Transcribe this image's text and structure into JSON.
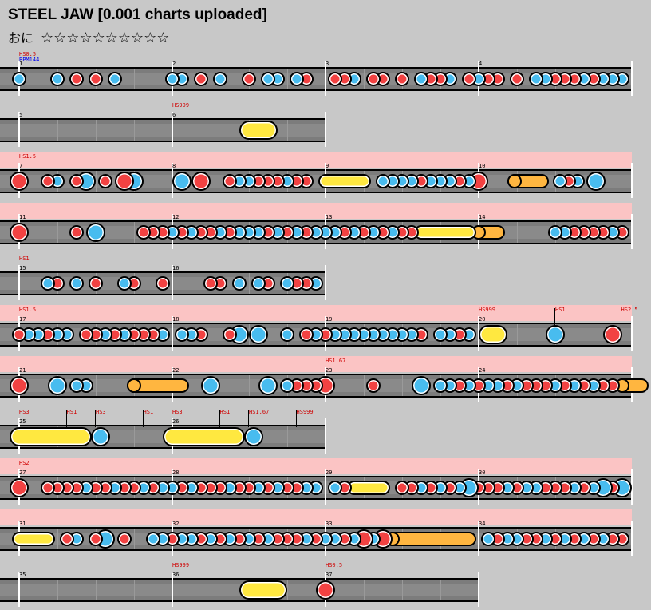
{
  "header": {
    "title": "STEEL JAW [0.001 charts uploaded]",
    "difficulty_label": "おに",
    "stars": "☆☆☆☆☆☆☆☆☆☆"
  },
  "colors": {
    "background": "#c8c8c8",
    "lane": "#7c7c7c",
    "don": "#f24242",
    "ka": "#48bcef",
    "drumroll": "#ffe840",
    "balloon": "#ffb640",
    "scroll_highlight": "#fbc4c4",
    "scroll_text": "#d00000",
    "bpm_text": "#0000ee"
  },
  "notation": {
    "d": "don",
    "k": "ka",
    "D": "big-don",
    "K": "big-ka",
    "r": "drumroll",
    "R": "big-drumroll",
    "b": "balloon",
    "e": "drumroll-end",
    "0": "rest"
  },
  "rows": [
    {
      "measures": 4,
      "highlight": false,
      "labels": [
        {
          "m": 1,
          "text": "HS0.5"
        }
      ],
      "bpm": [
        {
          "m": 1,
          "text": "BPM144"
        }
      ],
      "measure_numbers": [
        "1",
        "2",
        "3",
        "4"
      ],
      "lines": [
        "k000k0d0d0k00000",
        "kk0d0k00d0kk0kd0",
        "0ddk0dd0d0kddk0d",
        "kdd0d0kkdddkdkkk"
      ]
    },
    {
      "measures": 2,
      "highlight": false,
      "labels": [
        {
          "m": 2,
          "text": "HS999"
        }
      ],
      "measure_numbers": [
        "5",
        "6"
      ],
      "lines": [
        "0000000000000000",
        "00000000R0eeeeee"
      ]
    },
    {
      "measures": 4,
      "highlight": true,
      "labels": [
        {
          "m": 1,
          "text": "HS1.5"
        }
      ],
      "measure_numbers": [
        "7",
        "8",
        "9",
        "10"
      ],
      "lines": [
        "D00dk0dK0d0DK000",
        "0K0D00dkkdddkdd0",
        "r000e0kkkkdkkkdk",
        "D000b00e0kdk0K00e"
      ]
    },
    {
      "measures": 4,
      "highlight": true,
      "labels": [],
      "measure_numbers": [
        "11",
        "12",
        "13",
        "14"
      ],
      "lines": [
        "D000e0d0K0000ddd",
        "kdkddkdkkkdkdkdk",
        "kkdkdkdkddr0000e",
        "b0000000kkddddkd"
      ]
    },
    {
      "measures": 2,
      "highlight": false,
      "labels": [
        {
          "m": 1,
          "text": "HS1"
        }
      ],
      "measure_numbers": [
        "15",
        "16"
      ],
      "lines": [
        "000kd0k0d00kd00d",
        "0000dd0k0kd0kddk"
      ]
    },
    {
      "measures": 4,
      "highlight": true,
      "labels": [
        {
          "m": 1,
          "text": "HS1.5"
        },
        {
          "m": 4,
          "text": "HS999"
        },
        {
          "m": 4,
          "text": "HS1",
          "at": 0.5
        },
        {
          "m": 4,
          "text": "HS2.5",
          "at": 0.93
        }
      ],
      "measure_numbers": [
        "17",
        "18",
        "19",
        "20"
      ],
      "lines": [
        "dkkdkk0ddkdkdddk",
        "0kkd00dK0K00k0dk",
        "dkkkkkkkkkd0kkdk",
        "0Reeeee0K00000D0"
      ]
    },
    {
      "measures": 4,
      "highlight": true,
      "labels": [
        {
          "m": 3,
          "text": "HS1.67"
        }
      ],
      "measure_numbers": [
        "21",
        "22",
        "23",
        "24"
      ],
      "lines": [
        "D000K0kk0r00b000",
        "0e00K0r000K0kddd",
        "D0000d0000K0kkdk",
        "dkkdkdddkdkdkddb"
      ]
    },
    {
      "measures": 2,
      "highlight": false,
      "labels": [
        {
          "m": 1,
          "text": "HS3"
        },
        {
          "m": 1,
          "text": "HS1",
          "at": 0.31
        },
        {
          "m": 1,
          "text": "HS3",
          "at": 0.5
        },
        {
          "m": 1,
          "text": "HS1",
          "at": 0.81
        },
        {
          "m": 2,
          "text": "HS3"
        },
        {
          "m": 2,
          "text": "HS1",
          "at": 0.31
        },
        {
          "m": 2,
          "text": "HS1.67",
          "at": 0.5
        },
        {
          "m": 2,
          "text": "HS999",
          "at": 0.81
        }
      ],
      "measure_numbers": [
        "25",
        "26"
      ],
      "lines": [
        "R000000e0K000000e",
        "R000000e0K000000e"
      ]
    },
    {
      "measures": 4,
      "highlight": true,
      "labels": [
        {
          "m": 1,
          "text": "HS2"
        }
      ],
      "measure_numbers": [
        "27",
        "28",
        "29",
        "30"
      ],
      "lines": [
        "D00ddddkddkddkdk",
        "kdkdddkddkdkddkk",
        "0kdr00e0ddkdkdkK",
        "dddkdkkdddkdkKdK"
      ]
    },
    {
      "measures": 4,
      "highlight": true,
      "labels": [],
      "measure_numbers": [
        "31",
        "32",
        "33",
        "34"
      ],
      "lines": [
        "r00e0dk0dK0d00kk",
        "dkkdkdkdkdkdddkd",
        "kkdkDkDb0000000e",
        "0kdkkddkdkdkdkdd"
      ]
    },
    {
      "measures": 3,
      "highlight": false,
      "labels": [
        {
          "m": 2,
          "text": "HS999"
        },
        {
          "m": 3,
          "text": "HS0.5"
        }
      ],
      "measure_numbers": [
        "35",
        "36",
        "37"
      ],
      "lines": [
        "0000000000000000",
        "00000000R00e00e0",
        "D0000000"
      ]
    }
  ]
}
